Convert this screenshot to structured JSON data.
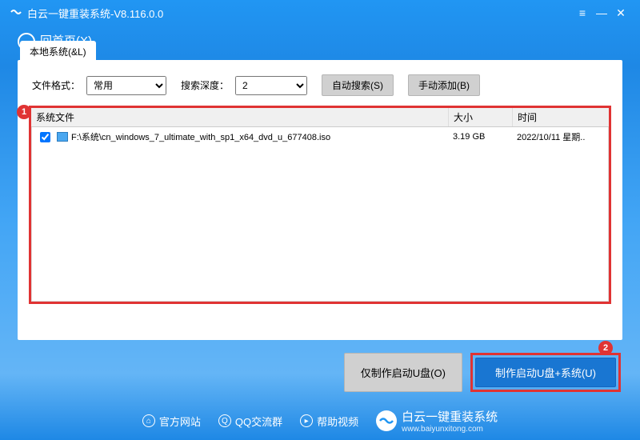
{
  "titlebar": {
    "title": "白云一键重装系统-V8.116.0.0"
  },
  "nav": {
    "back_label": "回首页(X)"
  },
  "tab": {
    "label": "本地系统(&L)"
  },
  "controls": {
    "file_format_label": "文件格式：",
    "file_format_value": "常用",
    "search_depth_label": "搜索深度：",
    "search_depth_value": "2",
    "auto_search_label": "自动搜索(S)",
    "manual_add_label": "手动添加(B)"
  },
  "table": {
    "headers": {
      "file": "系统文件",
      "size": "大小",
      "time": "时间"
    },
    "rows": [
      {
        "checked": true,
        "path": "F:\\系统\\cn_windows_7_ultimate_with_sp1_x64_dvd_u_677408.iso",
        "size": "3.19 GB",
        "time": "2022/10/11 星期.."
      }
    ]
  },
  "badges": {
    "one": "1",
    "two": "2"
  },
  "actions": {
    "make_usb_only": "仅制作启动U盘(O)",
    "make_usb_system": "制作启动U盘+系统(U)"
  },
  "footer": {
    "official_site": "官方网站",
    "qq_group": "QQ交流群",
    "help_video": "帮助视频",
    "brand": "白云一键重装系统",
    "url": "www.baiyunxitong.com"
  }
}
